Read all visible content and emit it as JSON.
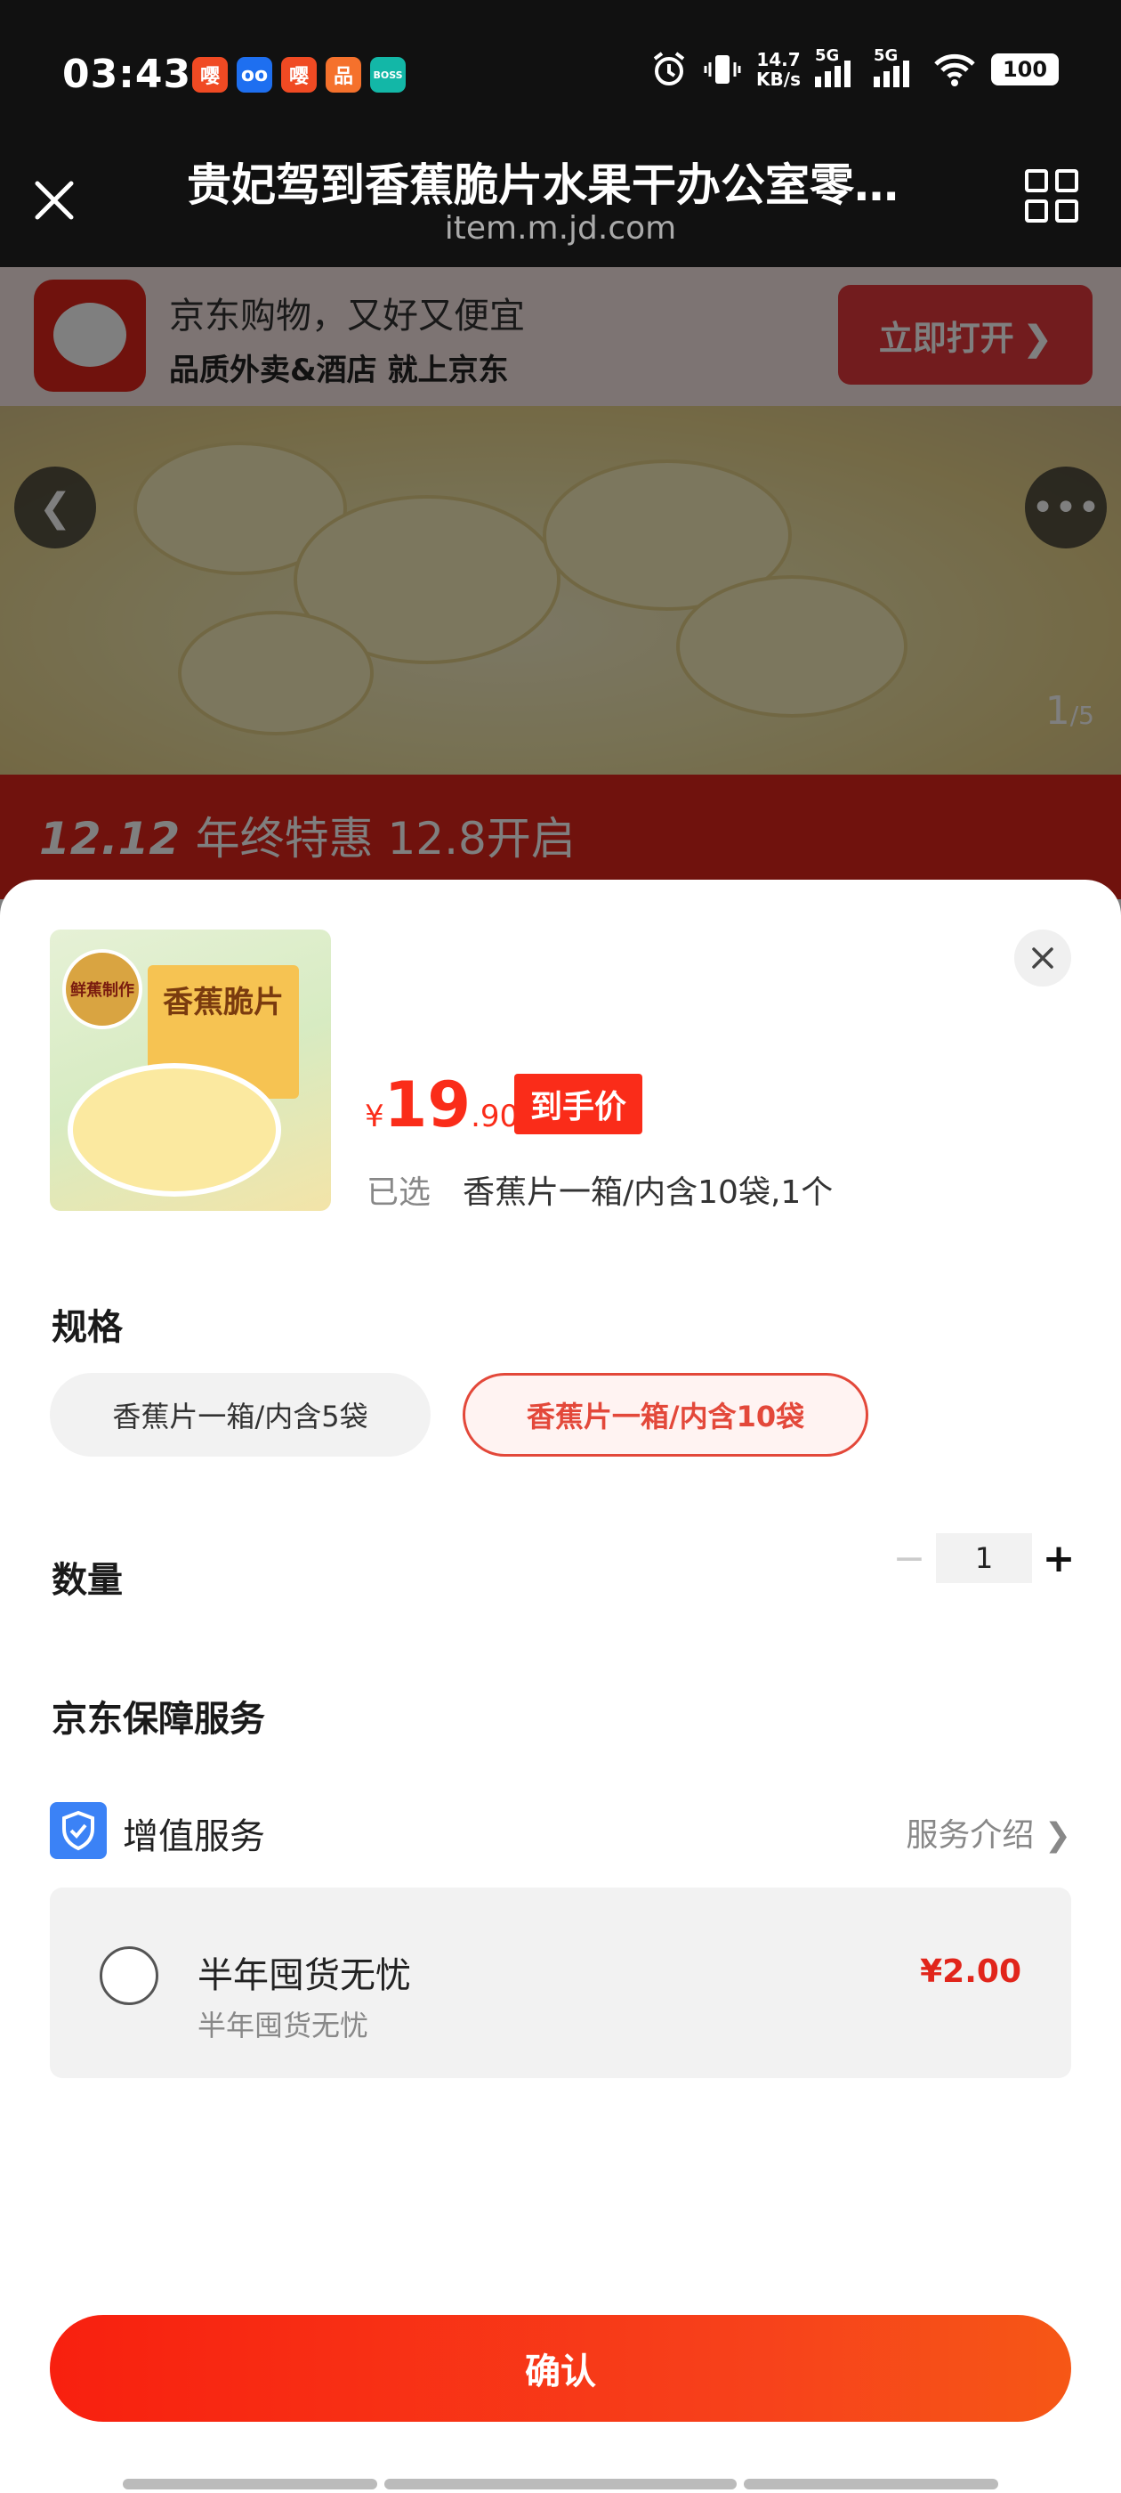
{
  "status_bar": {
    "time": "03:43",
    "apps": [
      {
        "icon": "app-red-icon",
        "glyph": "嘤",
        "color": "#f04a23"
      },
      {
        "icon": "app-blue-icon",
        "glyph": "oo",
        "color": "#1e6ff0"
      },
      {
        "icon": "app-red-icon-2",
        "glyph": "嘤",
        "color": "#f04a23"
      },
      {
        "icon": "app-orange-icon",
        "glyph": "品",
        "color": "#f5712c"
      },
      {
        "icon": "boss-app-icon",
        "glyph": "BOSS",
        "color": "#13b7a7"
      }
    ],
    "net_speed_value": "14.7",
    "net_speed_unit": "KB/s",
    "sig1": "5G",
    "sig2": "5G",
    "battery": "100"
  },
  "browser": {
    "title": "贵妃驾到香蕉脆片水果干办公室零…",
    "url": "item.m.jd.com"
  },
  "promo": {
    "line1": "京东购物，又好又便宜",
    "line2": "品质外卖&酒店 就上京东",
    "open_button": "立即打开 ❯"
  },
  "hero": {
    "counter_current": "1",
    "counter_total": "/5"
  },
  "sale": {
    "prefix": "12.12",
    "text": "年终特惠 12.8开启"
  },
  "sheet": {
    "thumb_box_text": "香蕉脆片",
    "thumb_badge_text": "鲜蕉制作",
    "price_symbol": "¥",
    "price_int": "19",
    "price_dec": ".90",
    "price_tag": "到手价",
    "selected_label": "已选",
    "selected_value": "香蕉片一箱/内含10袋,1个",
    "spec_title": "规格",
    "spec_options": [
      "香蕉片一箱/内含5袋",
      "香蕉片一箱/内含10袋"
    ],
    "spec_selected_index": 1,
    "qty_title": "数量",
    "qty_minus": "−",
    "qty_value": "1",
    "qty_plus": "+",
    "service_title": "京东保障服务",
    "service_label": "增值服务",
    "service_intro": "服务介绍  ❯",
    "service_item_name": "半年囤货无忧",
    "service_item_sub": "半年囤货无忧",
    "service_item_price": "¥2.00",
    "confirm": "确认"
  },
  "colors": {
    "accent": "#fa2c19",
    "jd_red": "#e1251b",
    "shield_blue": "#3b82f6"
  }
}
